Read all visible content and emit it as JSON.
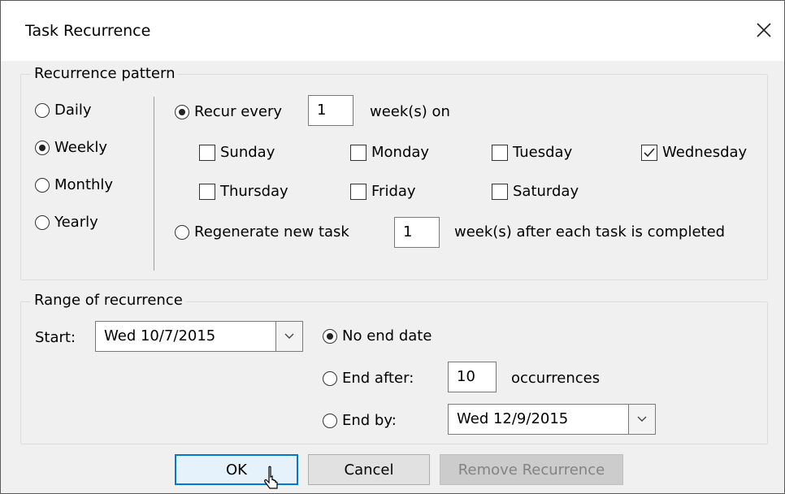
{
  "window": {
    "title": "Task Recurrence"
  },
  "pattern": {
    "legend": "Recurrence pattern",
    "types": [
      {
        "label": "Daily",
        "checked": false
      },
      {
        "label": "Weekly",
        "checked": true
      },
      {
        "label": "Monthly",
        "checked": false
      },
      {
        "label": "Yearly",
        "checked": false
      }
    ],
    "recur_every_label": "Recur every",
    "recur_every_value": "1",
    "weeks_on_label": "week(s) on",
    "days": [
      {
        "label": "Sunday",
        "checked": false
      },
      {
        "label": "Monday",
        "checked": false
      },
      {
        "label": "Tuesday",
        "checked": false
      },
      {
        "label": "Wednesday",
        "checked": true
      },
      {
        "label": "Thursday",
        "checked": false
      },
      {
        "label": "Friday",
        "checked": false
      },
      {
        "label": "Saturday",
        "checked": false
      }
    ],
    "regenerate_label": "Regenerate new task",
    "regenerate_value": "1",
    "regenerate_suffix": "week(s) after each task is completed"
  },
  "range": {
    "legend": "Range of recurrence",
    "start_label": "Start:",
    "start_value": "Wed 10/7/2015",
    "no_end_label": "No end date",
    "end_after_label": "End after:",
    "end_after_value": "10",
    "occurrences_label": "occurrences",
    "end_by_label": "End by:",
    "end_by_value": "Wed 12/9/2015"
  },
  "buttons": {
    "ok": "OK",
    "cancel": "Cancel",
    "remove": "Remove Recurrence"
  }
}
